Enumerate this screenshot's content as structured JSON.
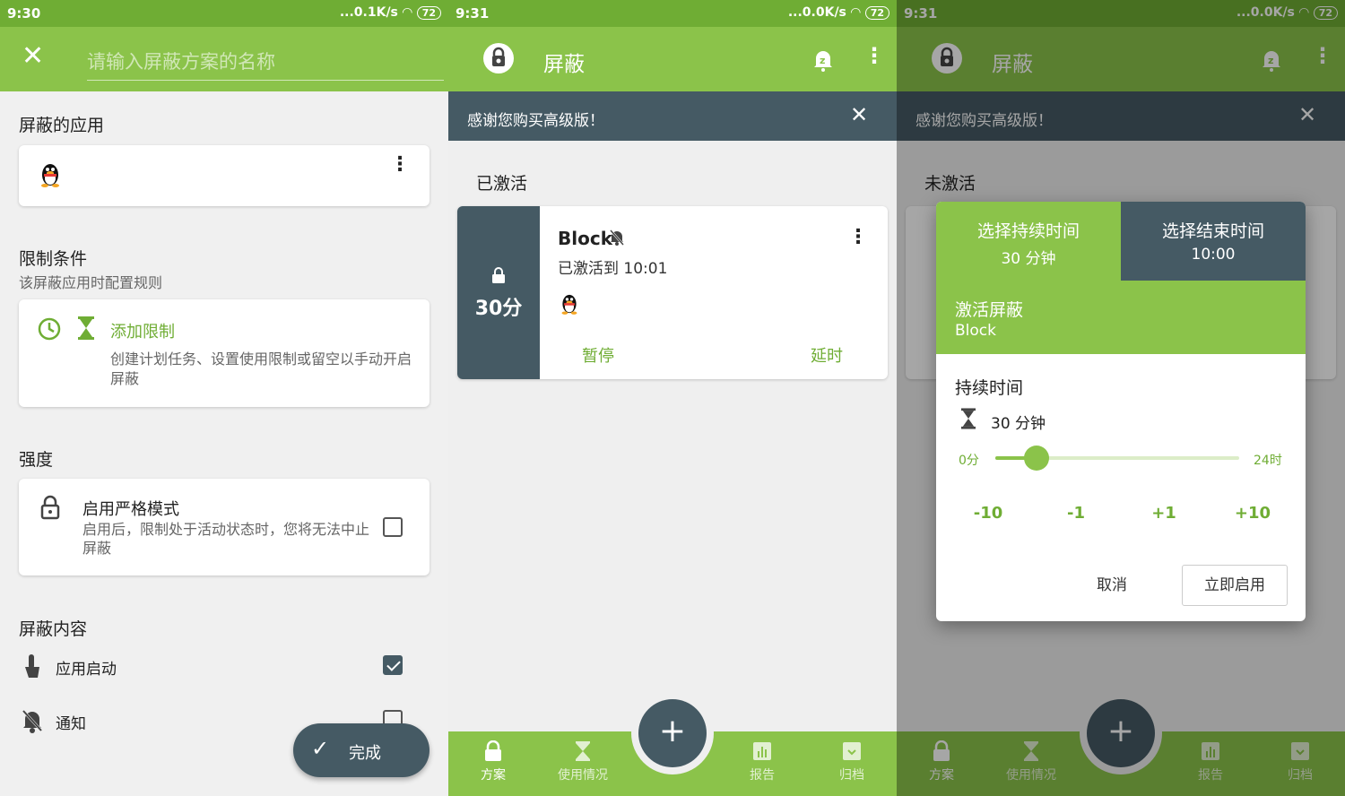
{
  "p1": {
    "status": {
      "time": "9:30",
      "speed": "...0.1K/s",
      "battery": "72"
    },
    "name_placeholder": "请输入屏蔽方案的名称",
    "sec_apps": "屏蔽的应用",
    "sec_limits": "限制条件",
    "sec_limits_sub": "该屏蔽应用时配置规则",
    "add_limit": "添加限制",
    "add_limit_desc": "创建计划任务、设置使用限制或留空以手动开启屏蔽",
    "sec_strength": "强度",
    "strict_title": "启用严格模式",
    "strict_desc": "启用后，限制处于活动状态时，您将无法中止屏蔽",
    "sec_content": "屏蔽内容",
    "content_launch": "应用启动",
    "content_notify": "通知",
    "done": "完成"
  },
  "p2": {
    "status": {
      "time": "9:31",
      "speed": "...0.0K/s",
      "battery": "72"
    },
    "title": "屏蔽",
    "banner": "感谢您购买高级版！",
    "section": "已激活",
    "block_name": "Block",
    "block_status": "已激活到 10:01",
    "block_duration": "30分",
    "pause": "暂停",
    "extend": "延时",
    "nav": [
      "方案",
      "使用情况",
      "报告",
      "归档"
    ]
  },
  "p3": {
    "status": {
      "time": "9:31",
      "speed": "...0.0K/s",
      "battery": "72"
    },
    "title": "屏蔽",
    "banner": "感谢您购买高级版！",
    "section": "未激活",
    "tab1_title": "选择持续时间",
    "tab1_value": "30 分钟",
    "tab2_title": "选择结束时间",
    "tab2_value": "10:00",
    "activate_title": "激活屏蔽",
    "activate_name": "Block",
    "duration_label": "持续时间",
    "duration_value": "30 分钟",
    "slider_min": "0分",
    "slider_max": "24时",
    "slider_fraction": 0.17,
    "steps": [
      "-10",
      "-1",
      "+1",
      "+10"
    ],
    "cancel": "取消",
    "start": "立即启用",
    "nav": [
      "方案",
      "使用情况",
      "报告",
      "归档"
    ]
  },
  "colors": {
    "green": "#8bc34a",
    "dark_green": "#6fad34",
    "slate": "#455a64"
  }
}
